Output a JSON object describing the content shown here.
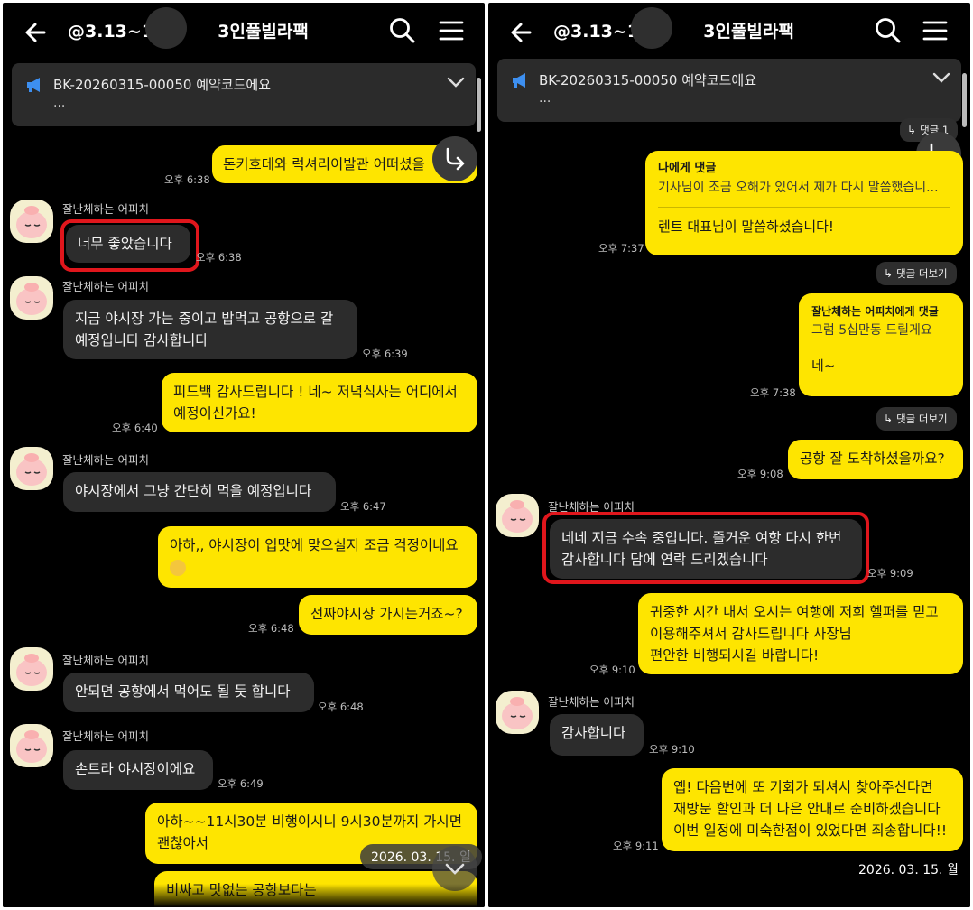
{
  "left": {
    "header": {
      "title_prefix": "@3.13~15",
      "title_suffix": "3인풀빌라팩"
    },
    "notice": {
      "text": "BK-20260315-00050 예약코드에요",
      "sub": "..."
    },
    "messages": [
      {
        "text": "돈키호테와 럭셔리이발관 어떠셨을",
        "time": "오후 6:38"
      },
      {
        "sender": "잘난체하는 어피치",
        "text": "너무 좋았습니다",
        "time": "오후 6:38"
      },
      {
        "sender": "잘난체하는 어피치",
        "text": "지금 야시장 가는 중이고 밥먹고 공항으로 갈\n예정입니다 감사합니다",
        "time": "오후 6:39"
      },
      {
        "text": "피드백 감사드립니다 ! 네~ 저녁식사는 어디에서\n예정이신가요!",
        "time": "오후 6:40"
      },
      {
        "sender": "잘난체하는 어피치",
        "text": "야시장에서 그냥 간단히 먹을 예정입니다",
        "time": "오후 6:47"
      },
      {
        "text": "아하,, 야시장이 입맛에 맞으실지 조금 걱정이네요",
        "time": ""
      },
      {
        "text": "선짜야시장 가시는거죠~?",
        "time": "오후 6:48"
      },
      {
        "sender": "잘난체하는 어피치",
        "text": "안되면 공항에서 먹어도 될 듯 합니다",
        "time": "오후 6:48"
      },
      {
        "sender": "잘난체하는 어피치",
        "text": "손트라 야시장이에요",
        "time": "오후 6:49"
      },
      {
        "text": "아하~~11시30분 비행이시니 9시30분까지 가시면\n괜찮아서",
        "time": ""
      },
      {
        "text": "비싸고 맛없는 공항보다는",
        "time": ""
      }
    ],
    "date_badge": "2026. 03. 15. 일"
  },
  "right": {
    "header": {
      "title_prefix": "@3.13~15",
      "title_suffix": "3인풀빌라팩"
    },
    "notice": {
      "text": "BK-20260315-00050 예약코드에요",
      "sub": "..."
    },
    "top_reply_chip": "댓글 1",
    "reply1": {
      "head": "나에게 댓글",
      "quote": "기사님이 조금 오해가 있어서 제가 다시 말씀했습니...",
      "body": "렌트 대표님이 말씀하셨습니다!",
      "time": "오후 7:37"
    },
    "more_replies": "댓글 더보기",
    "reply2": {
      "head": "잘난체하는 어피치에게 댓글",
      "quote": "그럼 5십만동 드릴게요",
      "body": "네~",
      "time": "오후 7:38"
    },
    "messages": [
      {
        "text": "공항 잘 도착하셨을까요?",
        "time": "오후 9:08"
      },
      {
        "sender": "잘난체하는 어피치",
        "text": "네네 지금 수속 중입니다. 즐거운 여항 다시 한번\n감사합니다 담에 연락 드리겠습니다",
        "time": "오후 9:09"
      },
      {
        "text": "귀중한 시간 내서 오시는 여행에 저희 헬퍼를 믿고\n이용해주셔서 감사드립니다 사장님\n편안한 비행되시길 바랍니다!",
        "time": "오후 9:10"
      },
      {
        "sender": "잘난체하는 어피치",
        "text": "감사합니다",
        "time": "오후 9:10"
      },
      {
        "text": "옙! 다음번에 또 기회가 되셔서 찾아주신다면\n재방문 할인과 더 나은 안내로 준비하겠습니다\n이번 일정에 미숙한점이 있었다면 죄송합니다!!",
        "time": "오후 9:11"
      }
    ],
    "date_badge": "2026. 03. 15. 월"
  },
  "colors": {
    "my_bubble": "#fee500",
    "other_bubble": "#2c2c2c",
    "background": "#000000",
    "highlight": "#e0161c"
  },
  "icons": [
    "back-arrow-icon",
    "search-icon",
    "menu-icon",
    "megaphone-icon",
    "chevron-down-icon",
    "reply-arrow-icon"
  ]
}
